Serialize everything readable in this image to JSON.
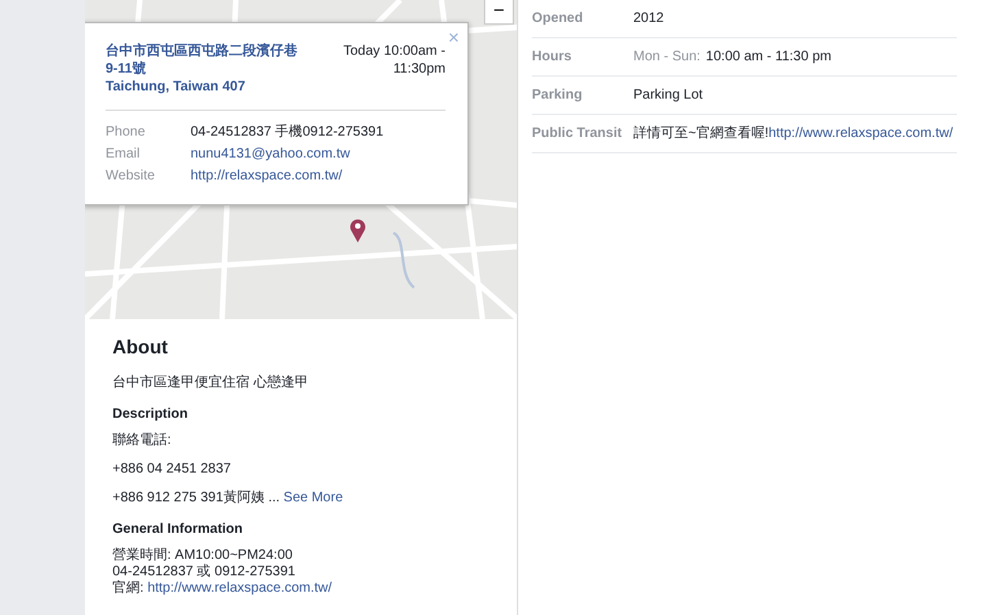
{
  "map": {
    "zoom_out": "−",
    "popup": {
      "close": "×",
      "address_lines": [
        "台中市西屯區西屯路二段濱仔巷",
        "9-11號",
        "Taichung, Taiwan 407"
      ],
      "hours_lines": [
        "Today 10:00am -",
        "11:30pm"
      ],
      "fields": [
        {
          "label": "Phone",
          "value": "04-24512837 手機0912-275391",
          "kind": "text"
        },
        {
          "label": "Email",
          "value": "nunu4131@yahoo.com.tw",
          "kind": "link"
        },
        {
          "label": "Website",
          "value": "http://relaxspace.com.tw/",
          "kind": "link"
        }
      ]
    }
  },
  "about": {
    "title": "About",
    "tagline": "台中市區逢甲便宜住宿 心戀逢甲",
    "description_heading": "Description",
    "description_lines": [
      "聯絡電話:",
      "+886 04 2451 2837",
      "+886 912 275 391黃阿姨 ..."
    ],
    "see_more": "See More",
    "general_heading": "General Information",
    "general_lines": [
      "營業時間: AM10:00~PM24:00",
      "04-24512837 或 0912-275391"
    ],
    "general_link_prefix": "官網: ",
    "general_link": "http://www.relaxspace.com.tw/"
  },
  "details": [
    {
      "label": "Opened",
      "value": "2012",
      "kind": "text"
    },
    {
      "label": "Hours",
      "days": "Mon - Sun:",
      "value": "10:00 am - 11:30 pm",
      "kind": "hours"
    },
    {
      "label": "Parking",
      "value": "Parking Lot",
      "kind": "text"
    },
    {
      "label": "Public Transit",
      "prefix": "詳情可至~官網查看喔!",
      "value": "http://www.relaxspace.com.tw/",
      "kind": "link"
    }
  ]
}
